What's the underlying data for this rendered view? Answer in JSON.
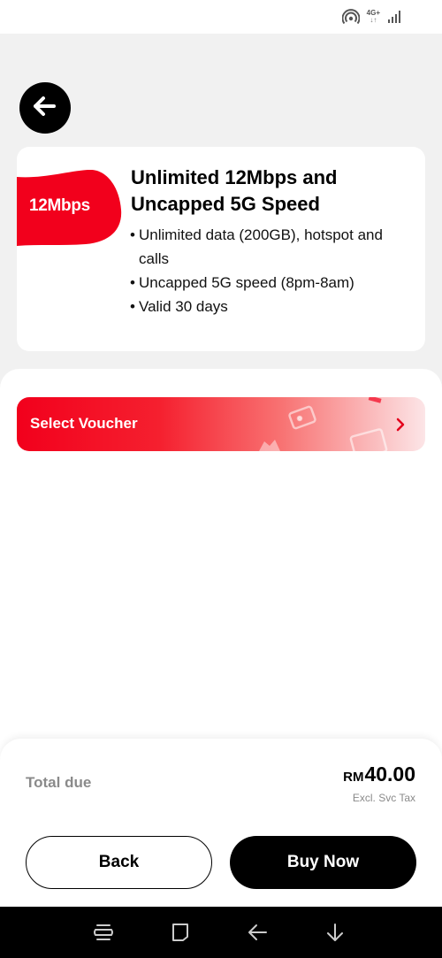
{
  "status_bar": {
    "network_label": "4G+"
  },
  "plan": {
    "speed_badge": "12Mbps",
    "title": "Unlimited 12Mbps and Uncapped 5G Speed",
    "features": [
      "Unlimited data (200GB), hotspot and calls",
      "Uncapped 5G speed (8pm-8am)",
      "Valid 30 days"
    ],
    "accent_color": "#f2001c"
  },
  "voucher": {
    "label": "Select Voucher"
  },
  "checkout": {
    "total_label": "Total due",
    "currency": "RM",
    "amount": "40.00",
    "tax_note": "Excl. Svc Tax",
    "back_label": "Back",
    "buy_label": "Buy Now"
  },
  "icons": {
    "back": "arrow-left-icon",
    "hotspot": "hotspot-icon",
    "signal": "signal-icon",
    "voucher_chevron": "chevron-right-icon",
    "nav_recents": "recents-icon",
    "nav_home": "home-icon",
    "nav_back": "back-icon",
    "nav_hide": "hide-keyboard-icon"
  }
}
